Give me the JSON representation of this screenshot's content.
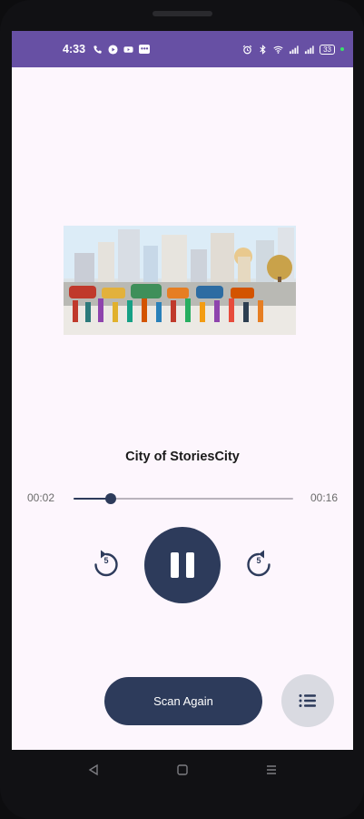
{
  "status_bar": {
    "time": "4:33",
    "left_icons": [
      "phone-icon",
      "play-circle-icon",
      "youtube-icon",
      "message-icon"
    ],
    "right_icons": [
      "alarm-icon",
      "bluetooth-icon",
      "wifi-icon",
      "signal-icon",
      "signal-icon"
    ],
    "battery_level": "33",
    "accent_color": "#6750a4"
  },
  "player": {
    "artwork_icon": "city-illustration",
    "title": "City of StoriesCity",
    "elapsed": "00:02",
    "total": "00:16",
    "progress": 0.17,
    "rewind_seconds": "5",
    "forward_seconds": "5",
    "state": "playing",
    "accent_color": "#2d3b5b"
  },
  "actions": {
    "scan_label": "Scan Again",
    "playlist_icon": "list-icon"
  },
  "nav": {
    "back_icon": "back-triangle-icon",
    "home_icon": "home-square-icon",
    "recents_icon": "recents-menu-icon"
  }
}
